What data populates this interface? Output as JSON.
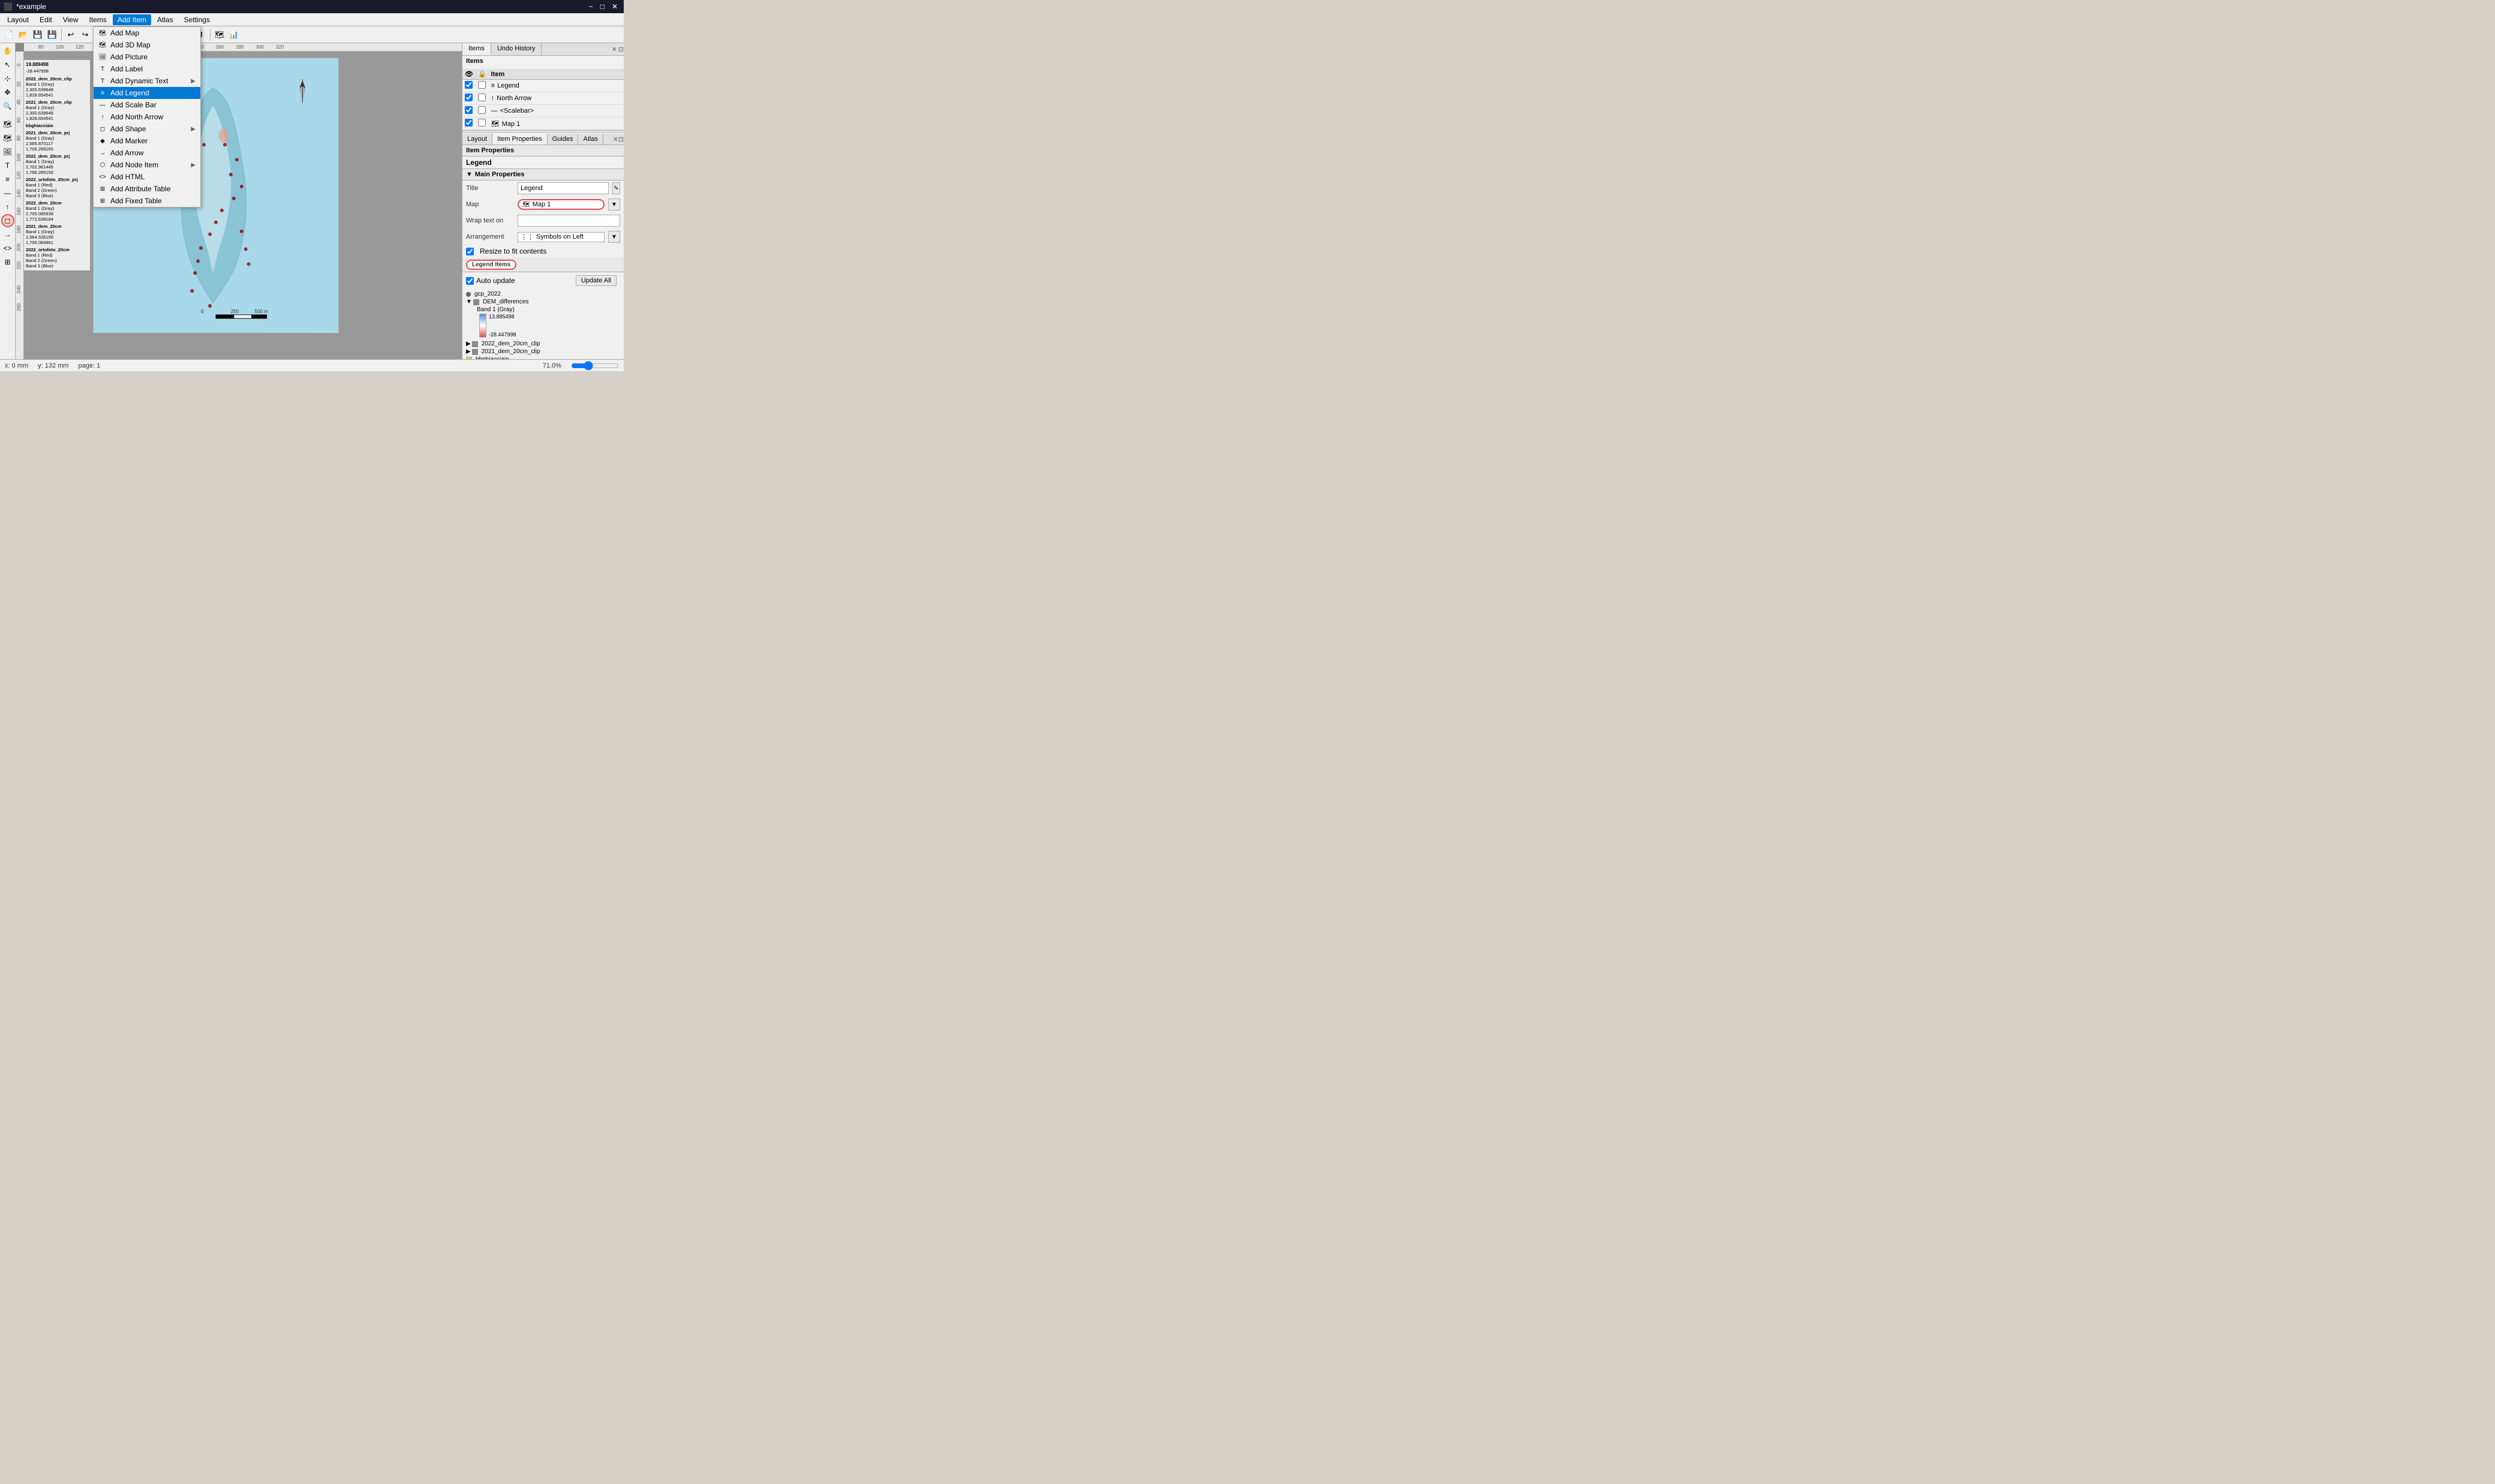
{
  "titlebar": {
    "title": "*example",
    "minimize": "−",
    "maximize": "□",
    "close": "✕"
  },
  "menubar": {
    "items": [
      "Layout",
      "Edit",
      "View",
      "Items",
      "Add Item",
      "Atlas",
      "Settings"
    ]
  },
  "additem_menu": {
    "title": "Add Item",
    "items": [
      {
        "label": "Add Map",
        "icon": "🗺",
        "hasSubmenu": false
      },
      {
        "label": "Add 3D Map",
        "icon": "🗺",
        "hasSubmenu": false
      },
      {
        "label": "Add Picture",
        "icon": "🖼",
        "hasSubmenu": false
      },
      {
        "label": "Add Label",
        "icon": "T",
        "hasSubmenu": false
      },
      {
        "label": "Add Dynamic Text",
        "icon": "T",
        "hasSubmenu": true
      },
      {
        "label": "Add Legend",
        "icon": "≡",
        "hasSubmenu": false,
        "highlighted": true
      },
      {
        "label": "Add Scale Bar",
        "icon": "—",
        "hasSubmenu": false
      },
      {
        "label": "Add North Arrow",
        "icon": "↑",
        "hasSubmenu": false
      },
      {
        "label": "Add Shape",
        "icon": "◻",
        "hasSubmenu": true
      },
      {
        "label": "Add Marker",
        "icon": "◆",
        "hasSubmenu": false
      },
      {
        "label": "Add Arrow",
        "icon": "→",
        "hasSubmenu": false
      },
      {
        "label": "Add Node Item",
        "icon": "⬡",
        "hasSubmenu": true
      },
      {
        "label": "Add HTML",
        "icon": "<>",
        "hasSubmenu": false
      },
      {
        "label": "Add Attribute Table",
        "icon": "⊞",
        "hasSubmenu": false
      },
      {
        "label": "Add Fixed Table",
        "icon": "⊞",
        "hasSubmenu": false
      }
    ]
  },
  "items_panel": {
    "title": "Items",
    "columns": [
      "",
      "",
      "Item"
    ],
    "rows": [
      {
        "visible": true,
        "locked": false,
        "name": "Legend",
        "icon": "≡"
      },
      {
        "visible": true,
        "locked": false,
        "name": "North Arrow",
        "icon": "↑"
      },
      {
        "visible": true,
        "locked": false,
        "name": "<Scalebar>",
        "icon": "—"
      },
      {
        "visible": true,
        "locked": false,
        "name": "Map 1",
        "icon": "🗺"
      }
    ],
    "tabs": [
      "Items",
      "Undo History"
    ]
  },
  "item_properties": {
    "section_title": "Item Properties",
    "subsection": "Legend",
    "main_properties_title": "Main Properties",
    "title_label": "Title",
    "title_value": "Legend",
    "map_label": "Map",
    "map_value": "Map 1",
    "wrap_label": "Wrap text on",
    "wrap_value": "",
    "arrangement_label": "Arrangement",
    "arrangement_value": "Symbols on Left",
    "resize_label": "Resize to fit contents",
    "resize_checked": true,
    "legend_items_title": "Legend Items",
    "auto_update_label": "Auto update",
    "auto_update_checked": true,
    "update_all_label": "Update All",
    "tabs": [
      "Layout",
      "Item Properties",
      "Guides",
      "Atlas"
    ]
  },
  "legend_tree": {
    "items": [
      {
        "type": "dot",
        "label": "gcp_2022",
        "color": "#888"
      },
      {
        "type": "group",
        "label": "DEM_differences",
        "children": [
          {
            "label": "Band 1 (Gray)",
            "gradient": true,
            "max": "13.885498",
            "min": "-28.447998"
          }
        ]
      },
      {
        "type": "group-collapsed",
        "label": "2022_dem_20cm_clip"
      },
      {
        "type": "group-collapsed",
        "label": "2021_dem_20cm_clip"
      },
      {
        "type": "color-square",
        "label": "bbghiacciaio",
        "color": "#e8c060"
      }
    ]
  },
  "status_bar": {
    "x": "x: 0 mm",
    "y": "y: 132 mm",
    "page": "page: 1",
    "zoom": "71.0%"
  },
  "legend_panel_items": [
    {
      "label": "2022_dem_20cm_clip",
      "sublabel": "Band 1 (Gray)",
      "values": [
        "2,300.639648",
        "1,828.654541"
      ]
    },
    {
      "label": "2021_dem_20cm_clip",
      "sublabel": "Band 1 (Gray)",
      "values": [
        "2,300.639648",
        "1,828.654541"
      ]
    },
    {
      "label": "bbghiacciaio"
    },
    {
      "label": "2021_dem_20cm_prj",
      "sublabel": "Band 1 (Gray)",
      "values": [
        "2,565.870117",
        "1,706.269165"
      ]
    },
    {
      "label": "2022_dem_20cm_prj",
      "sublabel": "Band 1 (Gray)",
      "values": [
        "2,702.981445",
        "1,766.285156"
      ]
    },
    {
      "label": "2022_ortofoto_20cm_prj",
      "sublabel": "Band 1 (Red)/Band 2 (Green)/Band 3 (Blue)"
    },
    {
      "label": "2022_dem_20cm",
      "sublabel": "Band 1 (Gray)",
      "values": [
        "2,700.085938",
        "1,772.638184"
      ]
    },
    {
      "label": "2021_dem_20cm",
      "sublabel": "Band 1 (Gray)",
      "values": [
        "2,564.535156",
        "1,706.084961"
      ]
    },
    {
      "label": "2022_ortofoto_20cm",
      "sublabel": "Band 1 (Red)/Band 2 (Green)/Band 3 (Blue)"
    }
  ]
}
